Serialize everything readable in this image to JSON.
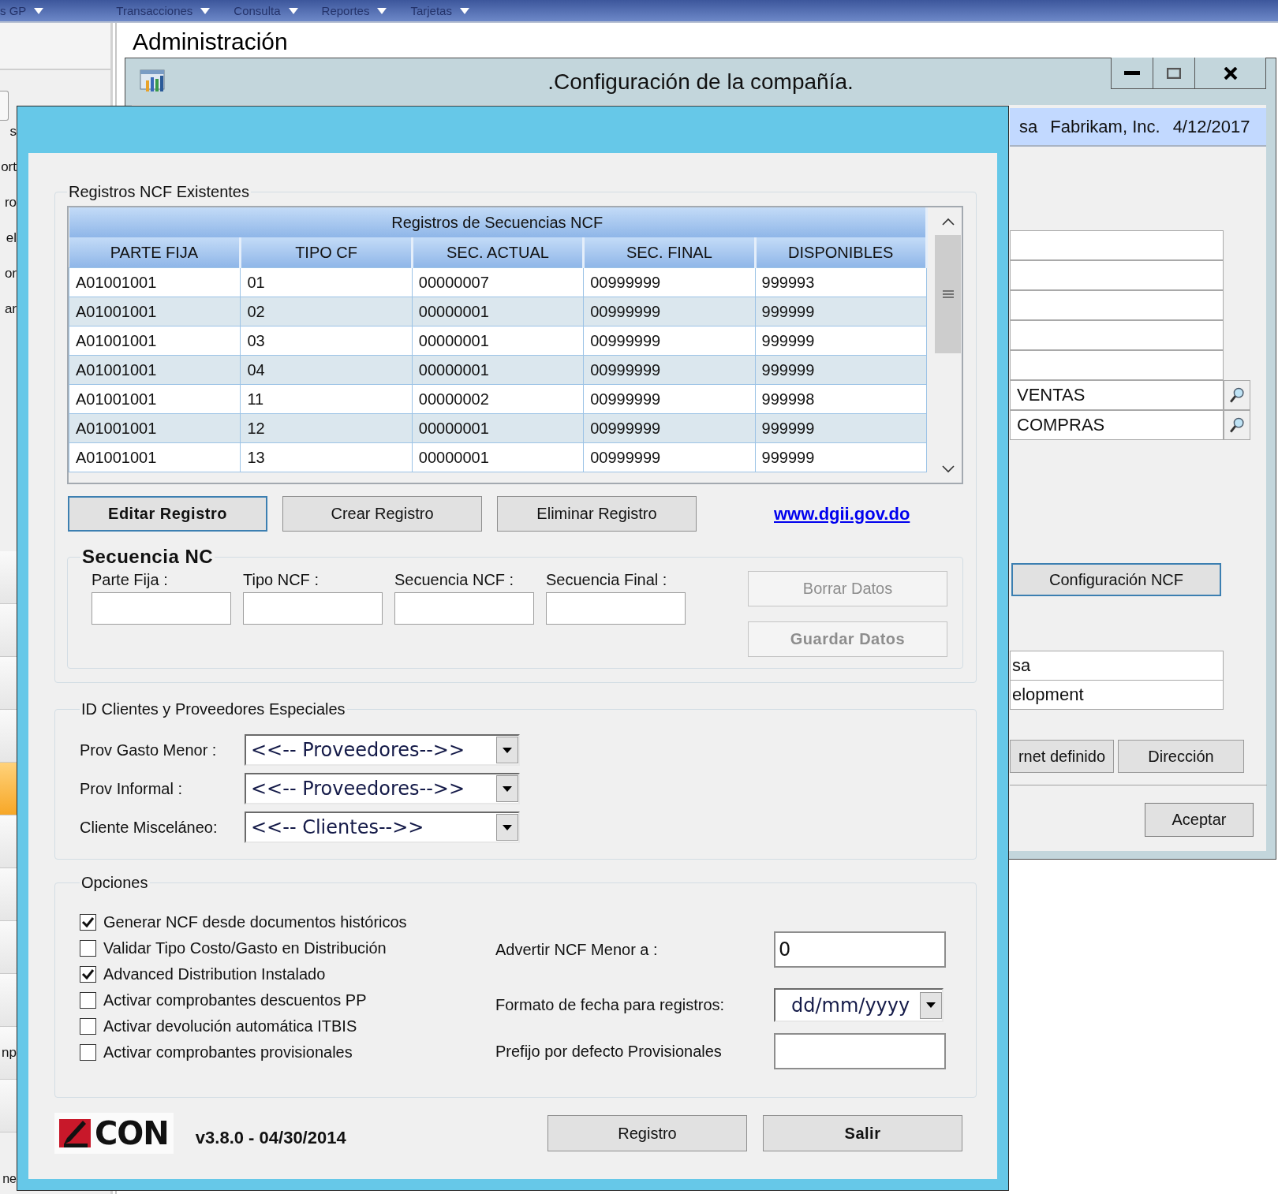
{
  "menu_bar": {
    "items": [
      "s GP",
      "Transacciones",
      "Consulta",
      "Reportes",
      "Tarjetas"
    ]
  },
  "sidebar": {
    "labels": [
      "s",
      "ort",
      "ro",
      "el",
      "or",
      "ar"
    ],
    "rows": [
      {
        "selected": false
      },
      {
        "selected": false
      },
      {
        "selected": false
      },
      {
        "selected": false
      },
      {
        "selected": true
      },
      {
        "selected": false
      },
      {
        "selected": false
      },
      {
        "selected": false
      },
      {
        "selected": false
      },
      {
        "label": "np",
        "selected": false
      },
      {
        "selected": false
      }
    ],
    "footer_text": "ne"
  },
  "admin_window": {
    "title": "Administración"
  },
  "config_window": {
    "title": ".Configuración de la compañía.",
    "user": "sa",
    "company": "Fabrikam, Inc.",
    "date": "4/12/2017",
    "fields": [
      {
        "kind": "text"
      },
      {
        "kind": "text"
      },
      {
        "kind": "text"
      },
      {
        "kind": "text"
      },
      {
        "kind": "text"
      },
      {
        "kind": "lookup",
        "value": "VENTAS"
      },
      {
        "kind": "lookup",
        "value": "COMPRAS"
      }
    ],
    "ncf_button": "Configuración NCF",
    "lower_fields": [
      "sa",
      "elopment"
    ],
    "buttons": [
      "rnet definido",
      "Dirección"
    ],
    "accept_button": "Aceptar"
  },
  "ncf_window": {
    "existing_group": {
      "title": "Registros NCF Existentes",
      "grid": {
        "title": "Registros de Secuencias NCF",
        "columns": [
          "PARTE FIJA",
          "TIPO CF",
          "SEC. ACTUAL",
          "SEC. FINAL",
          "DISPONIBLES"
        ],
        "rows": [
          [
            "A01001001",
            "01",
            "00000007",
            "00999999",
            "999993"
          ],
          [
            "A01001001",
            "02",
            "00000001",
            "00999999",
            "999999"
          ],
          [
            "A01001001",
            "03",
            "00000001",
            "00999999",
            "999999"
          ],
          [
            "A01001001",
            "04",
            "00000001",
            "00999999",
            "999999"
          ],
          [
            "A01001001",
            "11",
            "00000002",
            "00999999",
            "999998"
          ],
          [
            "A01001001",
            "12",
            "00000001",
            "00999999",
            "999999"
          ],
          [
            "A01001001",
            "13",
            "00000001",
            "00999999",
            "999999"
          ]
        ]
      },
      "actions": [
        {
          "label": "Editar Registro",
          "kind": "default",
          "focused": true
        },
        {
          "label": "Crear Registro",
          "kind": "normal",
          "focused": false
        },
        {
          "label": "Eliminar Registro",
          "kind": "normal",
          "focused": false
        }
      ],
      "link": "www.dgii.gov.do",
      "sequence_group": {
        "title": "Secuencia NC",
        "fields": [
          {
            "label": "Parte Fija :"
          },
          {
            "label": "Tipo  NCF :"
          },
          {
            "label": "Secuencia NCF :"
          },
          {
            "label": "Secuencia Final :"
          }
        ],
        "buttons": [
          {
            "label": "Borrar Datos",
            "kind": "normal",
            "disabled": true
          },
          {
            "label": "Guardar Datos",
            "kind": "default",
            "disabled": true
          }
        ]
      }
    },
    "special_ids": {
      "title": "ID Clientes y Proveedores Especiales",
      "rows": [
        {
          "label": "Prov Gasto Menor :",
          "value": "<<-- Proveedores-->>"
        },
        {
          "label": "Prov Informal :",
          "value": "<<-- Proveedores-->>"
        },
        {
          "label": "Cliente Misceláneo:",
          "value": "<<-- Clientes-->>"
        }
      ]
    },
    "options": {
      "title": "Opciones",
      "checkboxes": [
        {
          "label": "Generar NCF desde documentos históricos",
          "checked": true
        },
        {
          "label": "Validar Tipo Costo/Gasto en Distribución",
          "checked": false
        },
        {
          "label": "Advanced Distribution Instalado",
          "checked": true
        },
        {
          "label": "Activar comprobantes descuentos PP",
          "checked": false
        },
        {
          "label": "Activar devolución automática ITBIS",
          "checked": false
        },
        {
          "label": "Activar comprobantes provisionales",
          "checked": false
        }
      ],
      "settings": [
        {
          "kind": "input",
          "label": "Advertir NCF Menor a :",
          "value": "0"
        },
        {
          "kind": "select",
          "label": "Formato de fecha para registros:",
          "value": "dd/mm/yyyy"
        },
        {
          "kind": "input",
          "label": "Prefijo por defecto Provisionales"
        }
      ]
    },
    "footer": {
      "logo_text": "CON",
      "version": "v3.8.0 - 04/30/2014",
      "buttons": [
        {
          "label": "Registro",
          "kind": "normal"
        },
        {
          "label": "Salir",
          "kind": "default"
        }
      ]
    }
  }
}
